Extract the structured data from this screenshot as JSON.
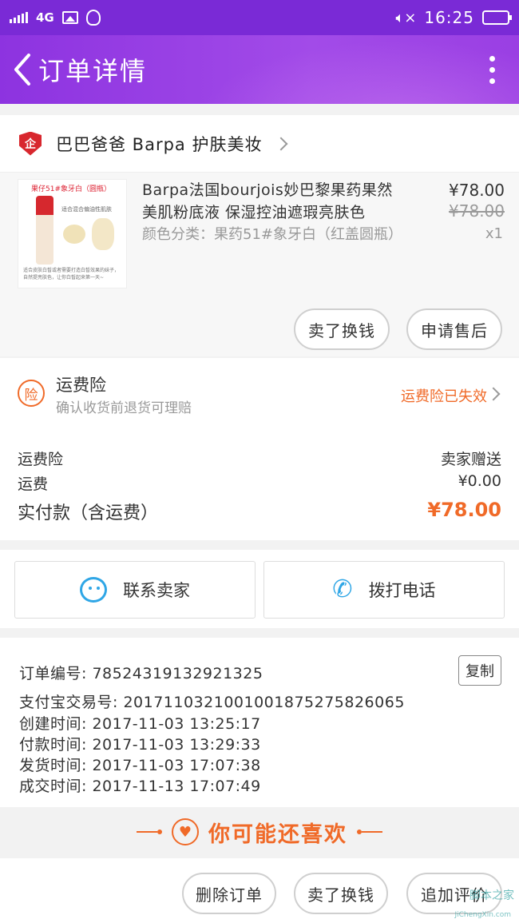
{
  "statusbar": {
    "network": "4G",
    "time": "16:25"
  },
  "header": {
    "title": "订单详情"
  },
  "shop": {
    "name": "巴巴爸爸 Barpa 护肤美妆",
    "badge": "企"
  },
  "product": {
    "thumb_title": "果仔51#象牙白（圆瓶）",
    "thumb_sub": "适合混合偏油性肌肤",
    "thumb_foot": "适合皮肤白皙或者需要打造白皙效果的妹子，自然提亮肤色，让你白皙起来第一天~",
    "name": "Barpa法国bourjois妙巴黎果药果然美肌粉底液 保湿控油遮瑕亮肤色",
    "sku": "颜色分类：果药51#象牙白（红盖圆瓶）",
    "price": "¥78.00",
    "original_price": "¥78.00",
    "quantity": "x1",
    "actions": {
      "sell_exchange": "卖了换钱",
      "after_sale": "申请售后"
    }
  },
  "insurance": {
    "badge": "险",
    "title": "运费险",
    "subtitle": "确认收货前退货可理赔",
    "status": "运费险已失效"
  },
  "payment": {
    "rows": [
      {
        "label": "运费险",
        "value": "卖家赠送"
      },
      {
        "label": "运费",
        "value": "¥0.00"
      }
    ],
    "total_label": "实付款（含运费）",
    "total_value": "¥78.00"
  },
  "contact": {
    "seller_label": "联系卖家",
    "phone_label": "拨打电话"
  },
  "order_info": {
    "lines": [
      "订单编号: 785243191329213​25",
      "支付宝交易号: 2017110321001001875275826065",
      "创建时间: 2017-11-03 13:25:17",
      "付款时间: 2017-11-03 13:29:33",
      "发货时间: 2017-11-03 17:07:38",
      "成交时间: 2017-11-13 17:07:49"
    ],
    "copy_label": "复制"
  },
  "recommend": {
    "title": "你可能还喜欢"
  },
  "bottom_actions": {
    "delete": "删除订单",
    "sell_exchange": "卖了换钱",
    "review": "追加评价"
  },
  "watermark": {
    "text": "脚本之家",
    "url": "JiChengXin.com"
  },
  "colors": {
    "accent": "#f06a28",
    "header": "#9a3fe3",
    "link_icon": "#2fa6e6"
  },
  "icons": [
    "back-arrow-icon",
    "more-vertical-icon",
    "shop-shield-icon",
    "chevron-right-icon",
    "insurance-icon",
    "chat-icon",
    "phone-icon",
    "heart-icon"
  ]
}
